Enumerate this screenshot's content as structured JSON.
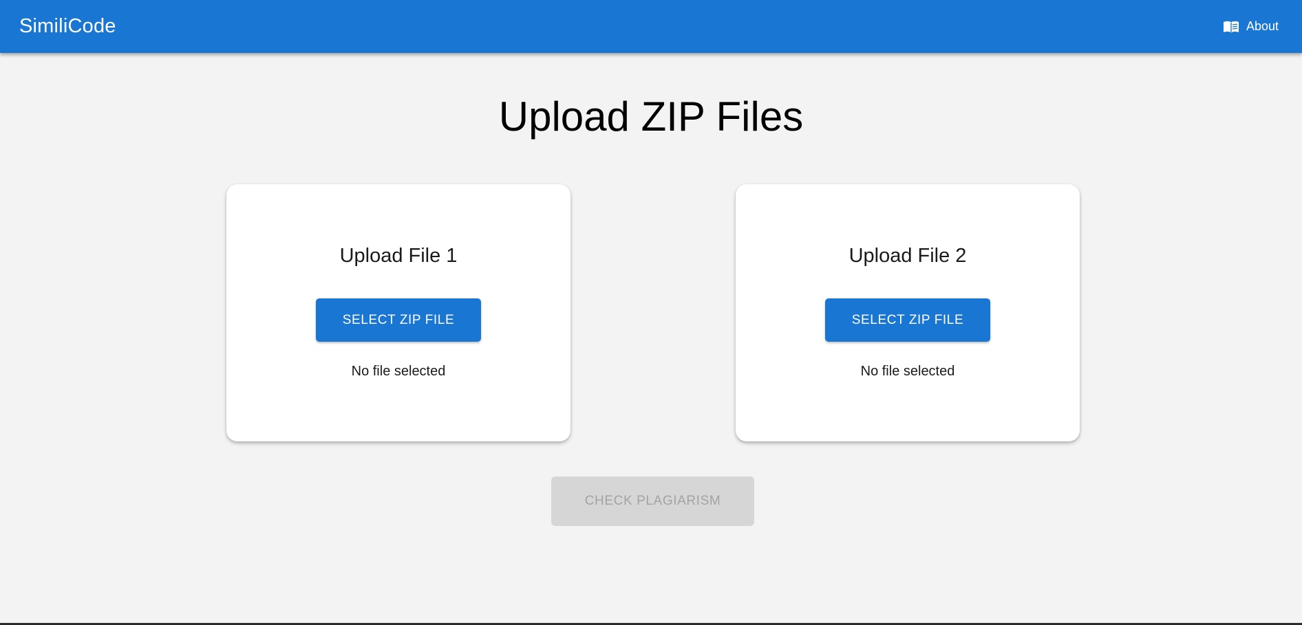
{
  "header": {
    "brand": "SimiliCode",
    "about_label": "About",
    "about_icon": "book-icon",
    "color": "#1976d2"
  },
  "main": {
    "title": "Upload ZIP Files",
    "cards": [
      {
        "title": "Upload File 1",
        "button_label": "SELECT ZIP FILE",
        "status": "No file selected"
      },
      {
        "title": "Upload File 2",
        "button_label": "SELECT ZIP FILE",
        "status": "No file selected"
      }
    ],
    "check_button_label": "CHECK PLAGIARISM",
    "check_button_disabled": true
  }
}
